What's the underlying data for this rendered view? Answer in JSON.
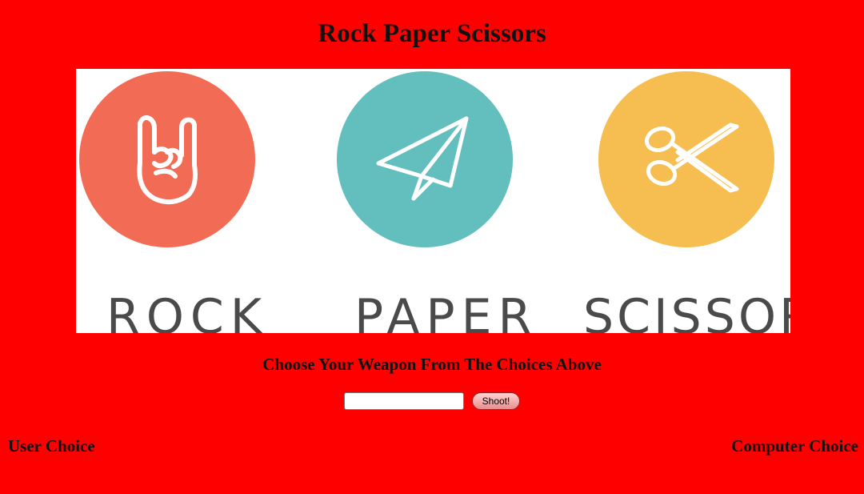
{
  "page": {
    "title": "Rock Paper Scissors",
    "subtitle": "Choose Your Weapon From The Choices Above"
  },
  "banner": {
    "weapons": [
      {
        "label": "ROCK",
        "icon": "rock-hand-icon",
        "color": "#f26b55"
      },
      {
        "label": "PAPER",
        "icon": "paper-plane-icon",
        "color": "#62bfbd"
      },
      {
        "label": "SCISSORS",
        "icon": "scissors-icon",
        "color": "#f6be50"
      }
    ]
  },
  "form": {
    "input_value": "",
    "input_placeholder": "",
    "shoot_label": "Shoot!"
  },
  "results": {
    "user_label": "User Choice",
    "computer_label": "Computer Choice"
  },
  "colors": {
    "background": "#fe0000"
  }
}
